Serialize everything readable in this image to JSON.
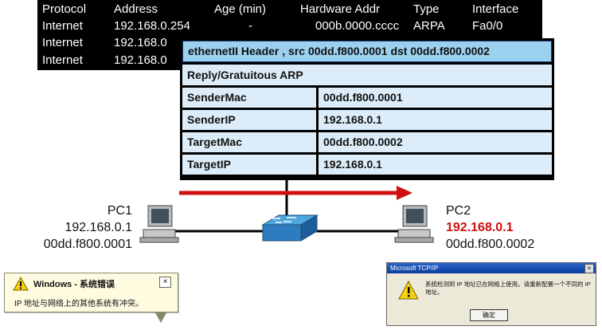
{
  "arp_table": {
    "headers": [
      "Protocol",
      "Address",
      "Age (min)",
      "Hardware Addr",
      "Type",
      "Interface"
    ],
    "rows": [
      [
        "Internet",
        "192.168.0.254",
        "-",
        "000b.0000.cccc",
        "ARPA",
        "Fa0/0"
      ],
      [
        "Internet",
        "192.168.0",
        "",
        "",
        "",
        ""
      ],
      [
        "Internet",
        "192.168.0",
        "",
        "",
        "",
        ""
      ]
    ]
  },
  "packet": {
    "header": "ethernetII Header , src 00dd.f800.0001 dst 00dd.f800.0002",
    "type": "Reply/Gratuitous ARP",
    "fields": [
      {
        "name": "SenderMac",
        "value": "00dd.f800.0001"
      },
      {
        "name": "SenderIP",
        "value": "192.168.0.1"
      },
      {
        "name": "TargetMac",
        "value": "00dd.f800.0002"
      },
      {
        "name": "TargetIP",
        "value": "192.168.0.1"
      }
    ]
  },
  "pc1": {
    "name": "PC1",
    "ip": "192.168.0.1",
    "mac": "00dd.f800.0001"
  },
  "pc2": {
    "name": "PC2",
    "ip": "192.168.0.1",
    "mac": "00dd.f800.0002"
  },
  "colors": {
    "arrow": "#d01010",
    "conflict_ip": "#d01010",
    "header_bg": "#9bd0ef",
    "field_bg": "#dcedf9"
  },
  "balloon": {
    "title": "Windows - 系统错误",
    "message": "IP 地址与网络上的其他系统有冲突。",
    "close": "×"
  },
  "dialog": {
    "title": "Microsoft TCP/IP",
    "message": "系统检测到 IP 地址已在网络上使用。请重新配置一个不同的 IP 地址。",
    "ok": "确定",
    "close": "×"
  }
}
